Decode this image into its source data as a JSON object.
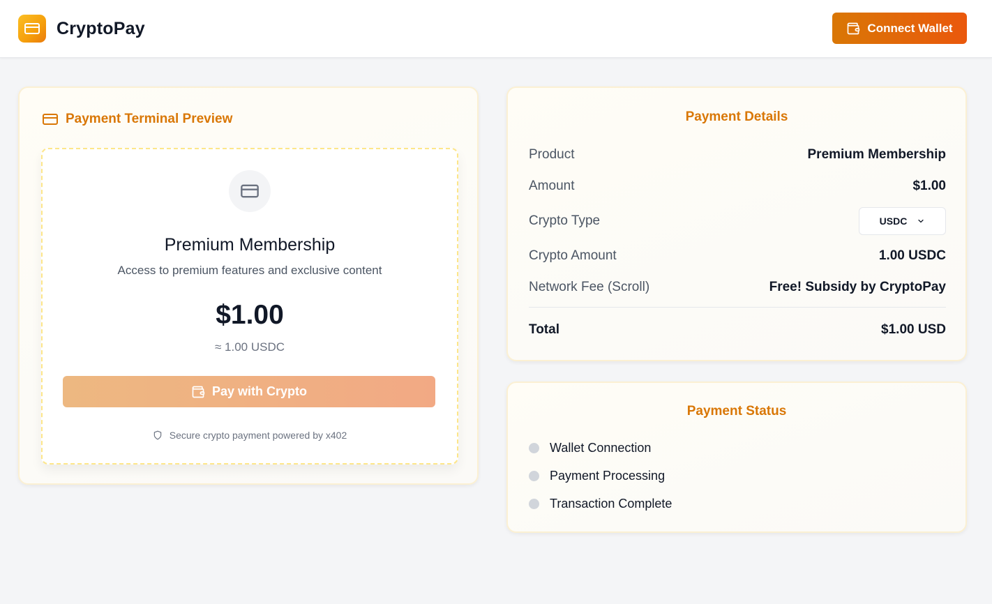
{
  "header": {
    "brand": "CryptoPay",
    "connect_label": "Connect Wallet",
    "logo_icon": "card-icon",
    "connect_icon": "wallet-icon",
    "accent": "#d97706"
  },
  "terminal": {
    "title": "Payment Terminal Preview",
    "title_icon": "card-icon",
    "product_icon": "card-icon",
    "product_name": "Premium Membership",
    "product_desc": "Access to premium features and exclusive content",
    "price": "$1.00",
    "approx": "≈ 1.00 USDC",
    "pay_label": "Pay with Crypto",
    "pay_icon": "wallet-icon",
    "secure_note": "Secure crypto payment powered by x402",
    "secure_icon": "shield-icon"
  },
  "details": {
    "title": "Payment Details",
    "product_label": "Product",
    "product_value": "Premium Membership",
    "amount_label": "Amount",
    "amount_value": "$1.00",
    "crypto_type_label": "Crypto Type",
    "crypto_type_value": "USDC",
    "crypto_amount_label": "Crypto Amount",
    "crypto_amount_value": "1.00 USDC",
    "fee_label": "Network Fee (Scroll)",
    "fee_value": "Free! Subsidy by CryptoPay",
    "total_label": "Total",
    "total_value": "$1.00 USD"
  },
  "status": {
    "title": "Payment Status",
    "items": [
      {
        "label": "Wallet Connection"
      },
      {
        "label": "Payment Processing"
      },
      {
        "label": "Transaction Complete"
      }
    ],
    "pending_color": "#d1d5db"
  }
}
